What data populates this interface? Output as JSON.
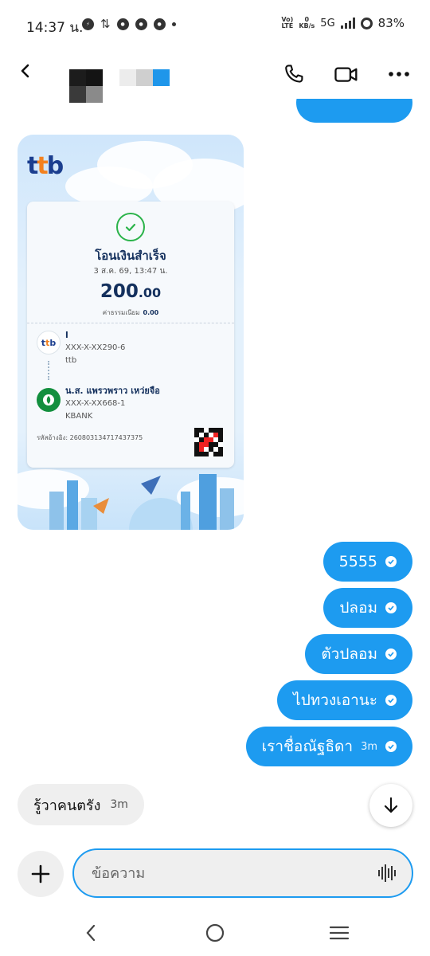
{
  "status_bar": {
    "time": "14:37 น.",
    "network_top": "Vo)",
    "network_bottom": "LTE",
    "speed_value": "0",
    "speed_unit": "KB/s",
    "network_type": "5G",
    "battery": "83%"
  },
  "header": {
    "contact_name": "",
    "icons": [
      "back-arrow-icon",
      "phone-icon",
      "video-camera-icon",
      "more-icon"
    ]
  },
  "receipt": {
    "bank_logo": "ttb",
    "status_title": "โอนเงินสำเร็จ",
    "date": "3 ส.ค. 69, 13:47 น.",
    "amount_main": "200",
    "amount_cents": ".00",
    "fee_label": "ค่าธรรมเนียม",
    "fee_value": "0.00",
    "sender": {
      "name": "l",
      "account": "XXX-X-XX290-6",
      "bank": "ttb"
    },
    "receiver": {
      "name": "น.ส. แพรวพราว เหว่ยจือ",
      "account": "XXX-X-XX668-1",
      "bank": "KBANK"
    },
    "reference": "รหัสอ้างอิง: 260803134717437375"
  },
  "messages_out": [
    {
      "text": "5555",
      "time": ""
    },
    {
      "text": "ปลอม",
      "time": ""
    },
    {
      "text": "ตัวปลอม",
      "time": ""
    },
    {
      "text": "ไปทวงเอานะ",
      "time": ""
    },
    {
      "text": "เราชื่อณัฐธิดา",
      "time": "3m"
    }
  ],
  "message_in": {
    "text": "รู้วาคนตรัง",
    "time": "3m"
  },
  "composer": {
    "placeholder": "ข้อความ"
  },
  "colors": {
    "accent": "#1d9bf0",
    "incoming_bubble": "#efefef",
    "receipt_navy": "#14305d",
    "success_green": "#2bb34a"
  }
}
